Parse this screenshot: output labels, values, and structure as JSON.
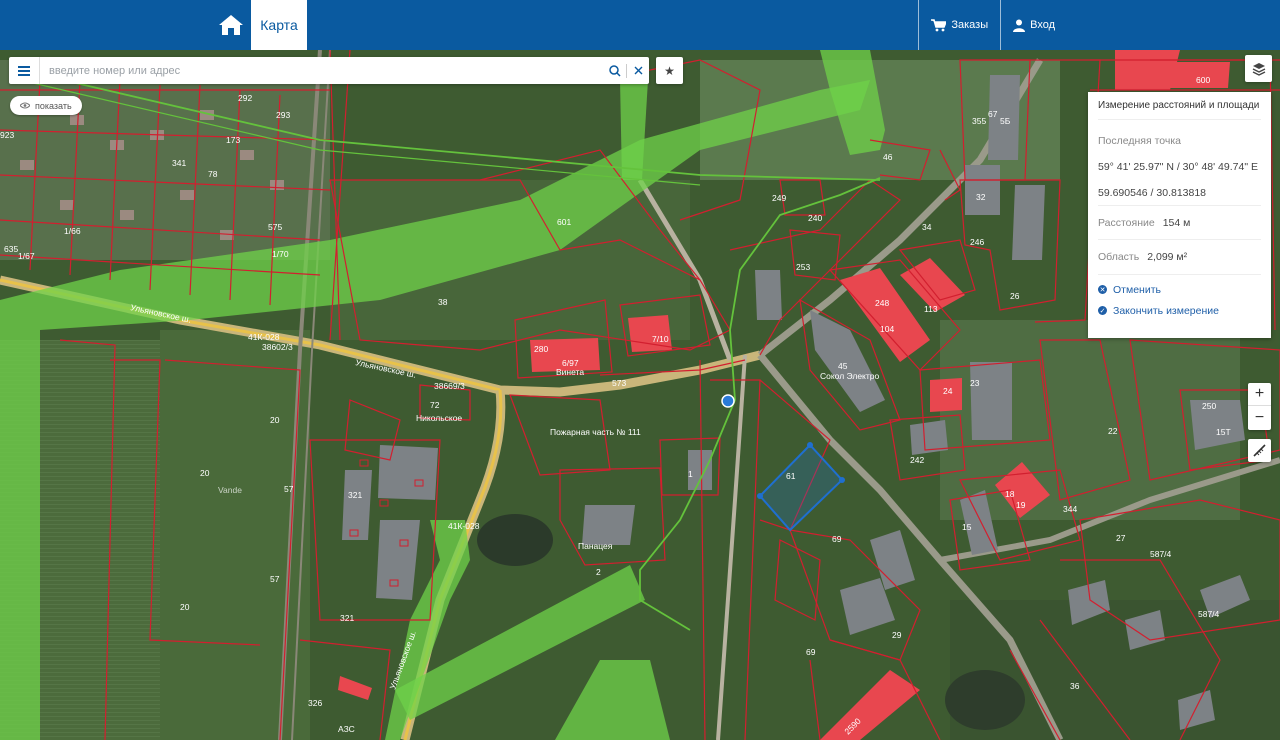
{
  "header": {
    "tab_map": "Карта",
    "orders": "Заказы",
    "login": "Вход"
  },
  "search": {
    "placeholder": "введите номер или адрес"
  },
  "show_button": "показать",
  "measure_panel": {
    "title": "Измерение расстояний и площади",
    "last_point_label": "Последняя точка",
    "coords_dms": "59° 41' 25.97\" N / 30° 48' 49.74\" E",
    "coords_dec": "59.690546 / 30.813818",
    "distance_label": "Расстояние",
    "distance_value": "154 м",
    "area_label": "Область",
    "area_value": "2,099 м²",
    "cancel": "Отменить",
    "finish": "Закончить измерение"
  },
  "zoom": {
    "in": "+",
    "out": "−"
  },
  "map_labels": {
    "roads": [
      "Ульяновское ш.",
      "Ульяновское ш.",
      "41К-028",
      "41К-028",
      "Ульяновское ш."
    ],
    "places": [
      "Винета",
      "Пожарная часть № 111",
      "Сокол Электро",
      "Никольское",
      "Панацея",
      "АЗС",
      "Vande"
    ],
    "parcels": [
      "292",
      "293",
      "173",
      "341",
      "78",
      "575",
      "1/66",
      "1/67",
      "1/70",
      "635",
      "923",
      "38",
      "601",
      "280",
      "6/97",
      "7/10",
      "573",
      "38669/3",
      "38602/3",
      "20",
      "20",
      "20",
      "57",
      "57",
      "321",
      "321",
      "326",
      "249",
      "240",
      "253",
      "248",
      "113",
      "104",
      "45",
      "24",
      "23",
      "246",
      "32",
      "26",
      "355",
      "67",
      "5Б",
      "46",
      "34",
      "242",
      "61",
      "69",
      "69",
      "29",
      "22",
      "250",
      "15Т",
      "18",
      "344",
      "27",
      "587/4",
      "587/4",
      "36",
      "15",
      "72",
      "2",
      "1",
      "600",
      "2590",
      "19"
    ]
  },
  "colors": {
    "header_bg": "#0a5aa0",
    "parcel_line": "#c8102e",
    "zone_green": "#6fd14a",
    "building_red": "#e8474f",
    "measure_blue": "#1f6fd0"
  }
}
